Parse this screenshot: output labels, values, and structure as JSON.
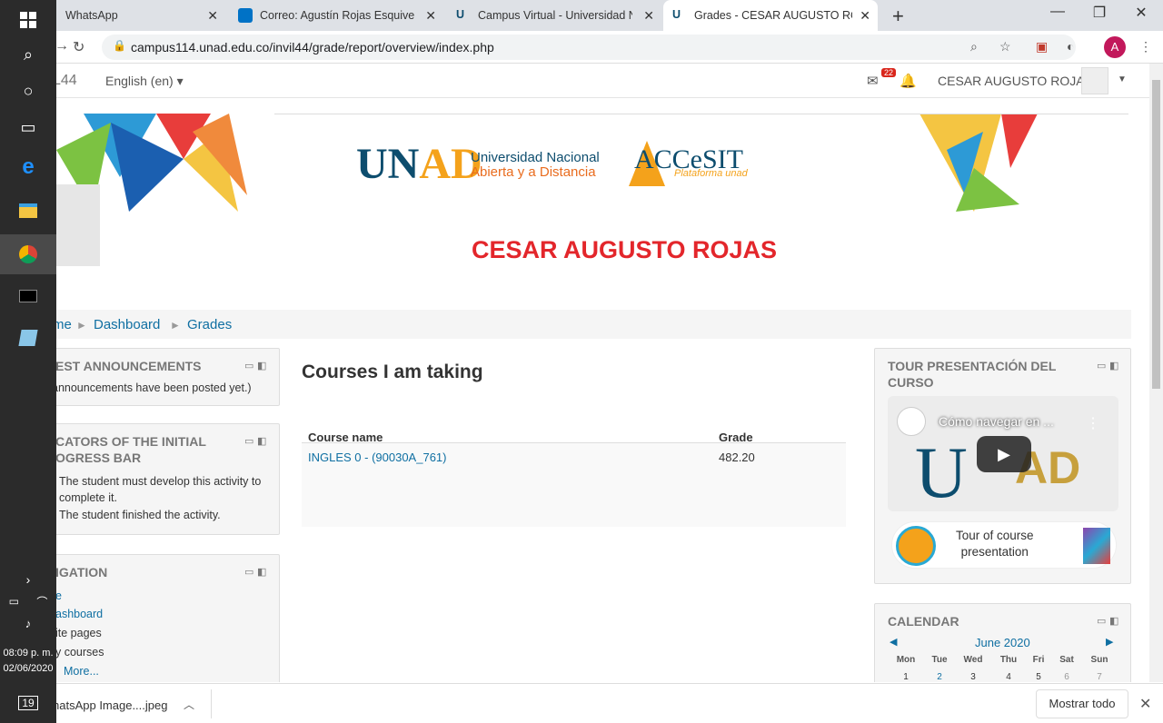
{
  "taskbar": {
    "time": "08:09 p. m.",
    "date": "02/06/2020",
    "notif_count": "19"
  },
  "browser": {
    "tabs": [
      {
        "title": "WhatsApp",
        "color": "#25d366"
      },
      {
        "title": "Correo: Agustín Rojas Esquivel - C",
        "color": "#0072c6"
      },
      {
        "title": "Campus Virtual - Universidad Na",
        "color": "#0d4d6e"
      },
      {
        "title": "Grades - CESAR AUGUSTO ROJAS",
        "color": "#0d4d6e"
      }
    ],
    "url": "campus114.unad.edu.co/invil44/grade/report/overview/index.php",
    "profile_initial": "A"
  },
  "navbar": {
    "brand": "L44",
    "language": "English (en) ▾",
    "message_count": "22",
    "user_name": "CESAR AUGUSTO ROJAS"
  },
  "banner": {
    "unad": "UN",
    "unad_ad": "AD",
    "unad_line1": "Universidad Nacional",
    "unad_line2": "Abierta y a Distancia",
    "accesit": "ACCeSIT",
    "accesit_sub": "Plataforma unad"
  },
  "page_title": "CESAR AUGUSTO ROJAS",
  "breadcrumb": {
    "home": "me",
    "sep": "►",
    "dashboard": "Dashboard",
    "grades": "Grades"
  },
  "left_blocks": {
    "announcements": {
      "title": "EST ANNOUNCEMENTS",
      "text": "announcements have been posted yet.)"
    },
    "indicators": {
      "title1": "CATORS OF THE INITIAL",
      "title2": "OGRESS BAR",
      "line1": "The student must develop this activity to",
      "line2": "complete it.",
      "line3": "The student finished the activity."
    },
    "navigation": {
      "title": "IGATION",
      "items": [
        "e",
        "ashboard",
        "ite pages",
        "y courses",
        "More..."
      ]
    }
  },
  "main": {
    "title": "Courses I am taking",
    "table": {
      "headers": [
        "Course name",
        "Grade"
      ],
      "rows": [
        {
          "course": "INGLES 0 - (90030A_761)",
          "grade": "482.20"
        }
      ]
    }
  },
  "right_blocks": {
    "tour": {
      "title1": "TOUR PRESENTACIÓN DEL",
      "title2": "CURSO",
      "video_title": "Cómo navegar en ...",
      "button_line1": "Tour of course",
      "button_line2": "presentation",
      "video_u": "U",
      "video_ad": "AD"
    },
    "calendar": {
      "title": "CALENDAR",
      "month": "June 2020",
      "days": [
        "Mon",
        "Tue",
        "Wed",
        "Thu",
        "Fri",
        "Sat",
        "Sun"
      ],
      "first_row": [
        "1",
        "2",
        "3",
        "4",
        "5",
        "6",
        "7"
      ]
    }
  },
  "downloads": {
    "file": "hatsApp Image....jpeg",
    "show_all": "Mostrar todo"
  }
}
